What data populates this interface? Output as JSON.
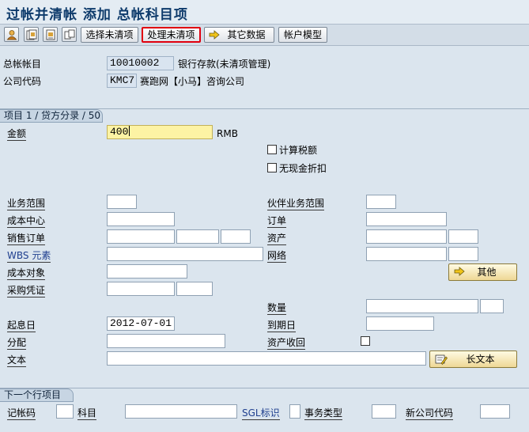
{
  "window": {
    "title": "过帐并清帐 添加 总帐科目项"
  },
  "toolbar": {
    "buttons": [
      "选择未清项",
      "处理未清项",
      "其它数据",
      "帐户模型"
    ]
  },
  "header": {
    "gl_account_label": "总帐帐目",
    "gl_account_value": "10010002",
    "gl_account_desc": "银行存款(未清项管理)",
    "company_code_label": "公司代码",
    "company_code_value": "KMC7",
    "company_code_desc": "赛跑网【小马】咨询公司"
  },
  "item_section": {
    "title": "项目 1 / 贷方分录 / 50",
    "amount_label": "金额",
    "amount_value": "400",
    "currency": "RMB",
    "calc_tax_label": "计算税额",
    "no_discount_label": "无现金折扣",
    "business_area_label": "业务范围",
    "partner_ba_label": "伙伴业务范围",
    "cost_center_label": "成本中心",
    "order_label": "订单",
    "sales_order_label": "销售订单",
    "asset_label": "资产",
    "wbs_label": "WBS 元素",
    "network_label": "网络",
    "cost_object_label": "成本对象",
    "other_button": "其他",
    "purchase_doc_label": "采购凭证",
    "quantity_label": "数量",
    "value_date_label": "起息日",
    "value_date_value": "2012-07-01",
    "due_date_label": "到期日",
    "assignment_label": "分配",
    "asset_retirement_label": "资产收回",
    "text_label": "文本",
    "long_text_button": "长文本"
  },
  "next_item": {
    "title": "下一个行项目",
    "posting_key_label": "记帐码",
    "account_label": "科目",
    "sgl_label": "SGL标识",
    "trans_type_label": "事务类型",
    "new_company_label": "新公司代码"
  }
}
